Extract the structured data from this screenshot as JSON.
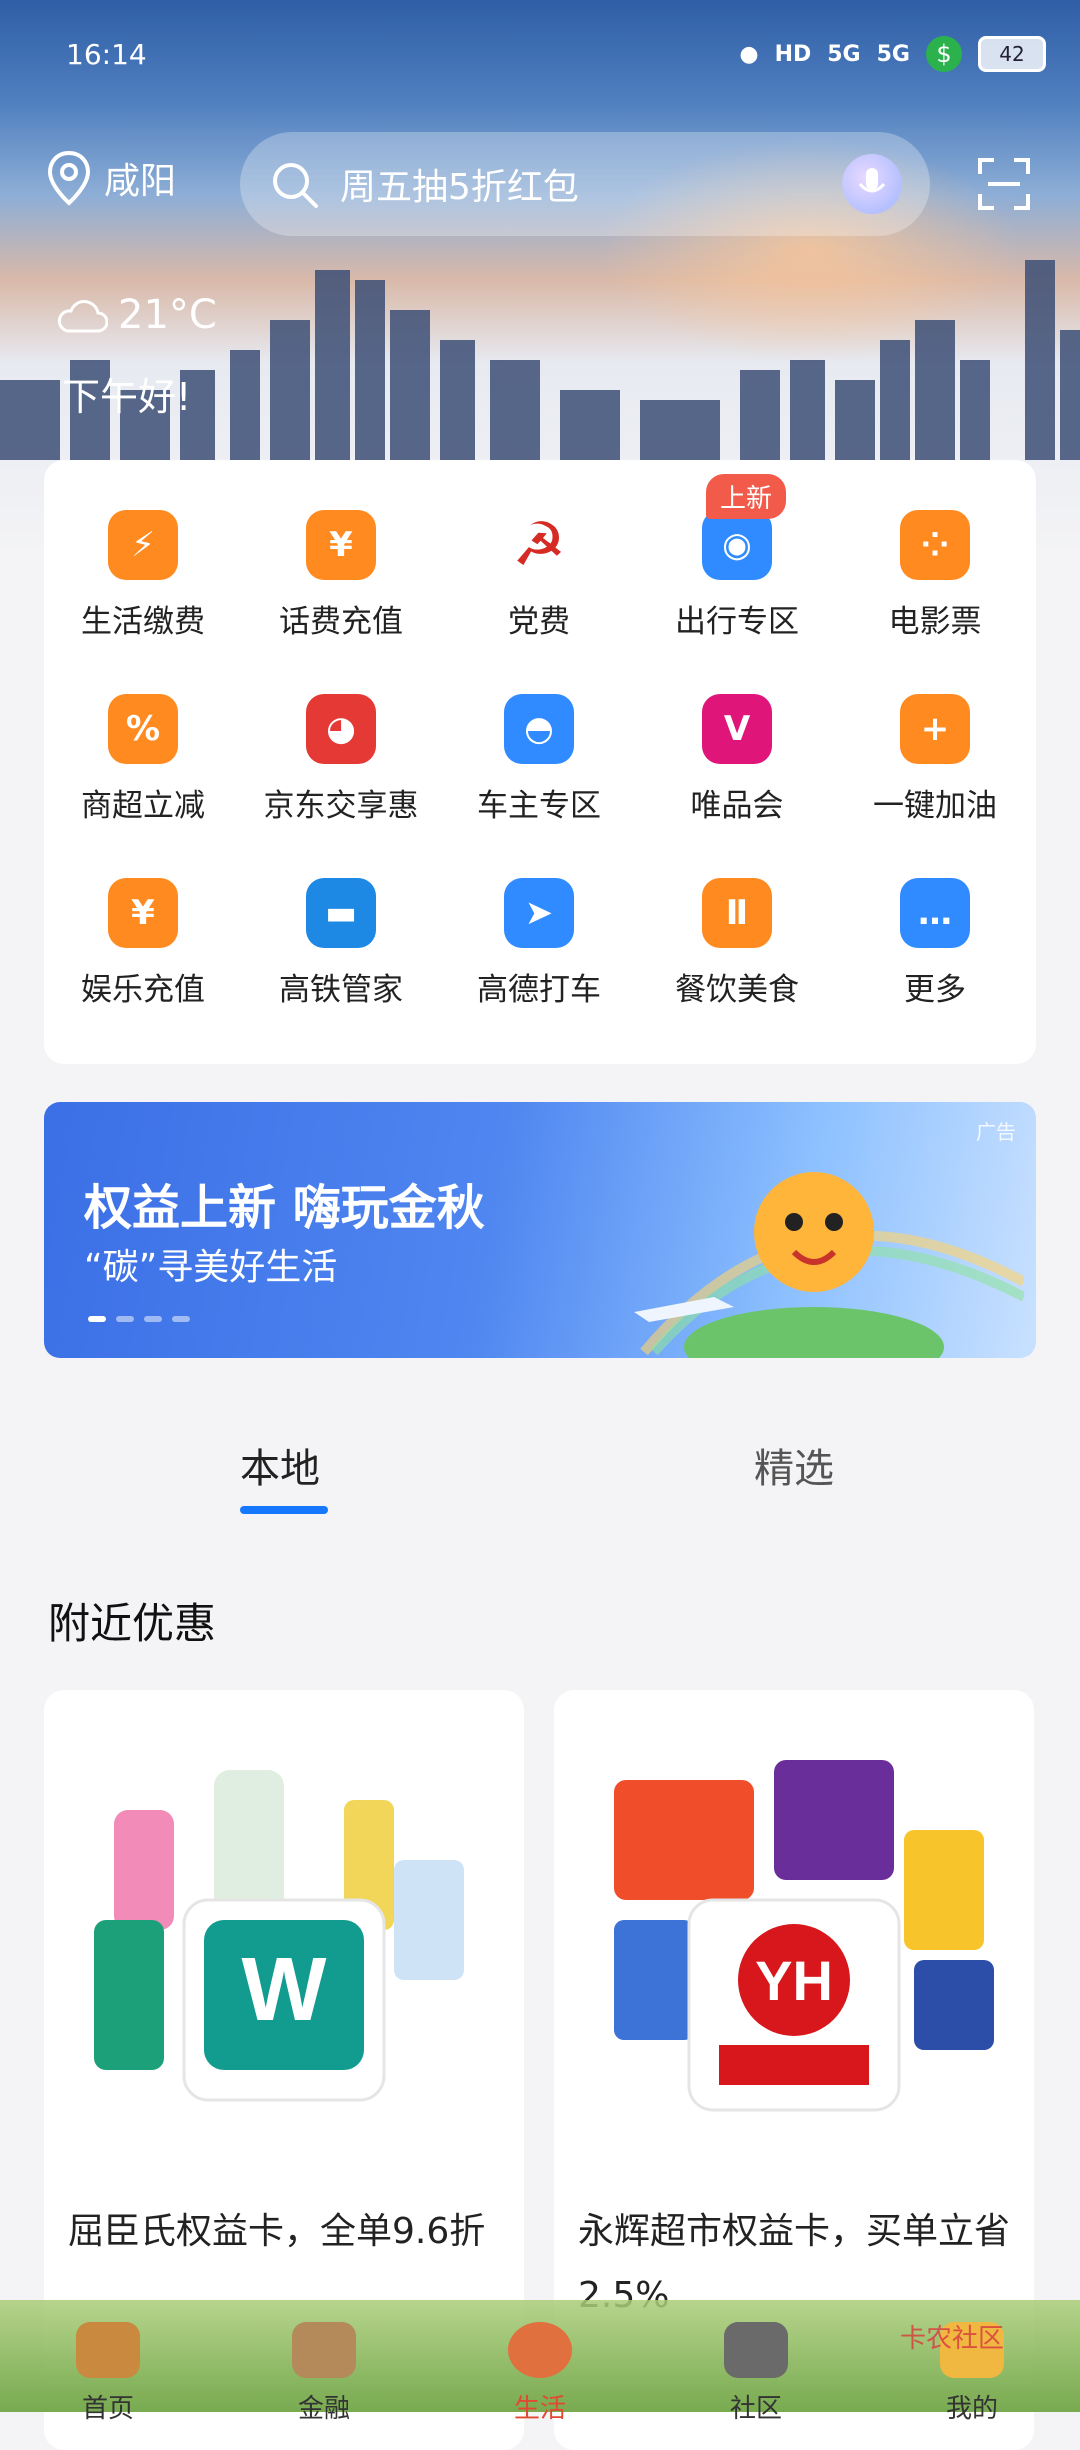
{
  "status_bar": {
    "time": "16:14",
    "network": "5G",
    "battery": "42"
  },
  "header": {
    "location": "咸阳",
    "search_placeholder": "周五抽5折红包",
    "weather_temp": "21°C",
    "greeting": "下午好!"
  },
  "services": [
    {
      "label": "生活缴费",
      "icon": "lightning-drop-icon",
      "color": "#ff8a1f"
    },
    {
      "label": "话费充值",
      "icon": "phone-yen-icon",
      "color": "#ff8a1f"
    },
    {
      "label": "党费",
      "icon": "hammer-sickle-icon",
      "color": "#d62a24"
    },
    {
      "label": "出行专区",
      "icon": "map-pin-icon",
      "color": "#2f8bff",
      "badge": "上新"
    },
    {
      "label": "电影票",
      "icon": "film-reel-icon",
      "color": "#ff8a1f"
    },
    {
      "label": "商超立减",
      "icon": "percent-tag-icon",
      "color": "#ff8a1f"
    },
    {
      "label": "京东交享惠",
      "icon": "jd-dog-icon",
      "color": "#e53935"
    },
    {
      "label": "车主专区",
      "icon": "driver-icon",
      "color": "#2f8bff"
    },
    {
      "label": "唯品会",
      "icon": "vip-logo-icon",
      "color": "#e0157a"
    },
    {
      "label": "一键加油",
      "icon": "fuel-plus-icon",
      "color": "#ff8a1f"
    },
    {
      "label": "娱乐充值",
      "icon": "yen-card-icon",
      "color": "#ff8a1f"
    },
    {
      "label": "高铁管家",
      "icon": "train-icon",
      "color": "#1e88e5"
    },
    {
      "label": "高德打车",
      "icon": "amap-arrow-icon",
      "color": "#2f8bff"
    },
    {
      "label": "餐饮美食",
      "icon": "fork-spoon-icon",
      "color": "#ff8a1f"
    },
    {
      "label": "更多",
      "icon": "more-dots-icon",
      "color": "#2f8bff"
    }
  ],
  "banner": {
    "title": "权益上新 嗨玩金秋",
    "subtitle": "“碳”寻美好生活",
    "ad_label": "广告"
  },
  "tabs": [
    {
      "label": "本地"
    },
    {
      "label": "精选"
    }
  ],
  "section_title": "附近优惠",
  "deals": [
    {
      "text": "屈臣氏权益卡，全单9.6折",
      "logo": "watsons-logo",
      "logo_color": "#129c8f"
    },
    {
      "text": "永辉超市权益卡，买单立省2.5%",
      "logo": "yonghui-logo",
      "logo_color": "#d8171c"
    }
  ],
  "bottom_nav": [
    {
      "label": "首页"
    },
    {
      "label": "金融"
    },
    {
      "label": "生活"
    },
    {
      "label": "社区"
    },
    {
      "label": "我的"
    }
  ],
  "watermark": "卡农社区"
}
